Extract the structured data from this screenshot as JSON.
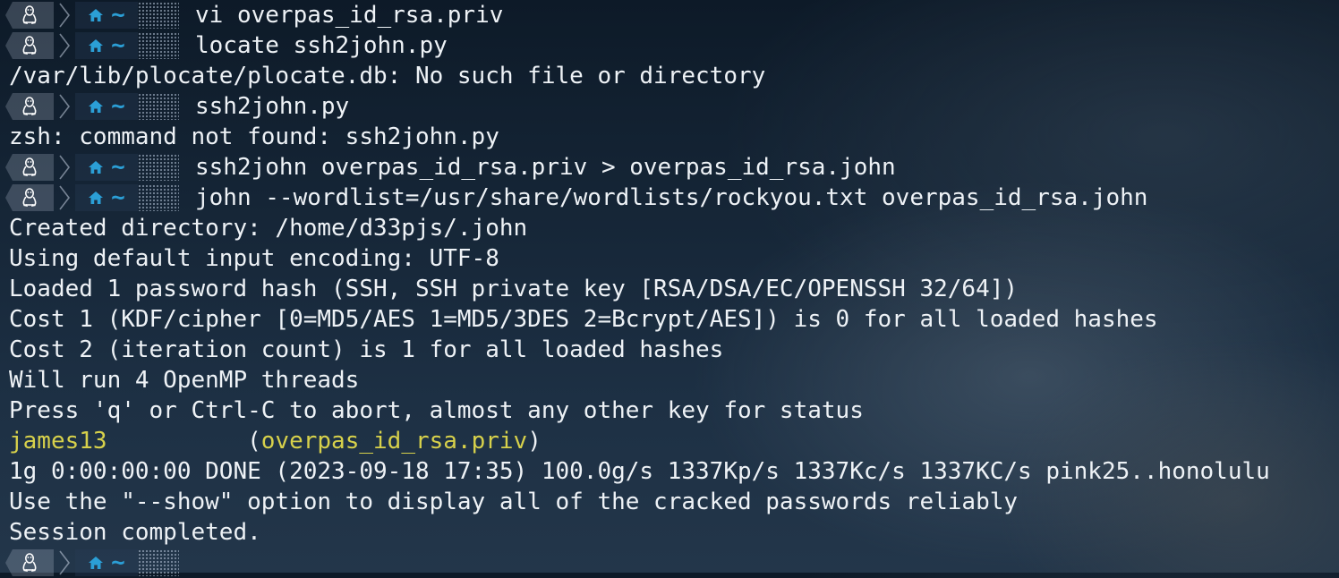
{
  "terminal": {
    "prompt": {
      "dir_symbol": "~",
      "os_icon": "tux-icon",
      "home_icon": "home-icon"
    },
    "lines": [
      {
        "type": "prompt",
        "cmd": "vi overpas_id_rsa.priv"
      },
      {
        "type": "prompt",
        "cmd": "locate ssh2john.py"
      },
      {
        "type": "output",
        "text": "/var/lib/plocate/plocate.db: No such file or directory"
      },
      {
        "type": "prompt",
        "cmd": "ssh2john.py"
      },
      {
        "type": "output",
        "text": "zsh: command not found: ssh2john.py"
      },
      {
        "type": "prompt",
        "cmd": "ssh2john overpas_id_rsa.priv > overpas_id_rsa.john"
      },
      {
        "type": "prompt",
        "cmd": "john --wordlist=/usr/share/wordlists/rockyou.txt overpas_id_rsa.john"
      },
      {
        "type": "output",
        "text": "Created directory: /home/d33pjs/.john"
      },
      {
        "type": "output",
        "text": "Using default input encoding: UTF-8"
      },
      {
        "type": "output",
        "text": "Loaded 1 password hash (SSH, SSH private key [RSA/DSA/EC/OPENSSH 32/64])"
      },
      {
        "type": "output",
        "text": "Cost 1 (KDF/cipher [0=MD5/AES 1=MD5/3DES 2=Bcrypt/AES]) is 0 for all loaded hashes"
      },
      {
        "type": "output",
        "text": "Cost 2 (iteration count) is 1 for all loaded hashes"
      },
      {
        "type": "output",
        "text": "Will run 4 OpenMP threads"
      },
      {
        "type": "output",
        "text": "Press 'q' or Ctrl-C to abort, almost any other key for status"
      },
      {
        "type": "result",
        "password": "james13",
        "pad": "          ",
        "open": "(",
        "file": "overpas_id_rsa.priv",
        "close": ")"
      },
      {
        "type": "output",
        "text": "1g 0:00:00:00 DONE (2023-09-18 17:35) 100.0g/s 1337Kp/s 1337Kc/s 1337KC/s pink25..honolulu"
      },
      {
        "type": "output",
        "text": "Use the \"--show\" option to display all of the cracked passwords reliably"
      },
      {
        "type": "output",
        "text": "Session completed."
      },
      {
        "type": "prompt",
        "cmd": ""
      }
    ]
  },
  "colors": {
    "text": "#eef2f6",
    "highlight_yellow": "#d7d14b",
    "dir_blue": "#2b9fd6"
  }
}
